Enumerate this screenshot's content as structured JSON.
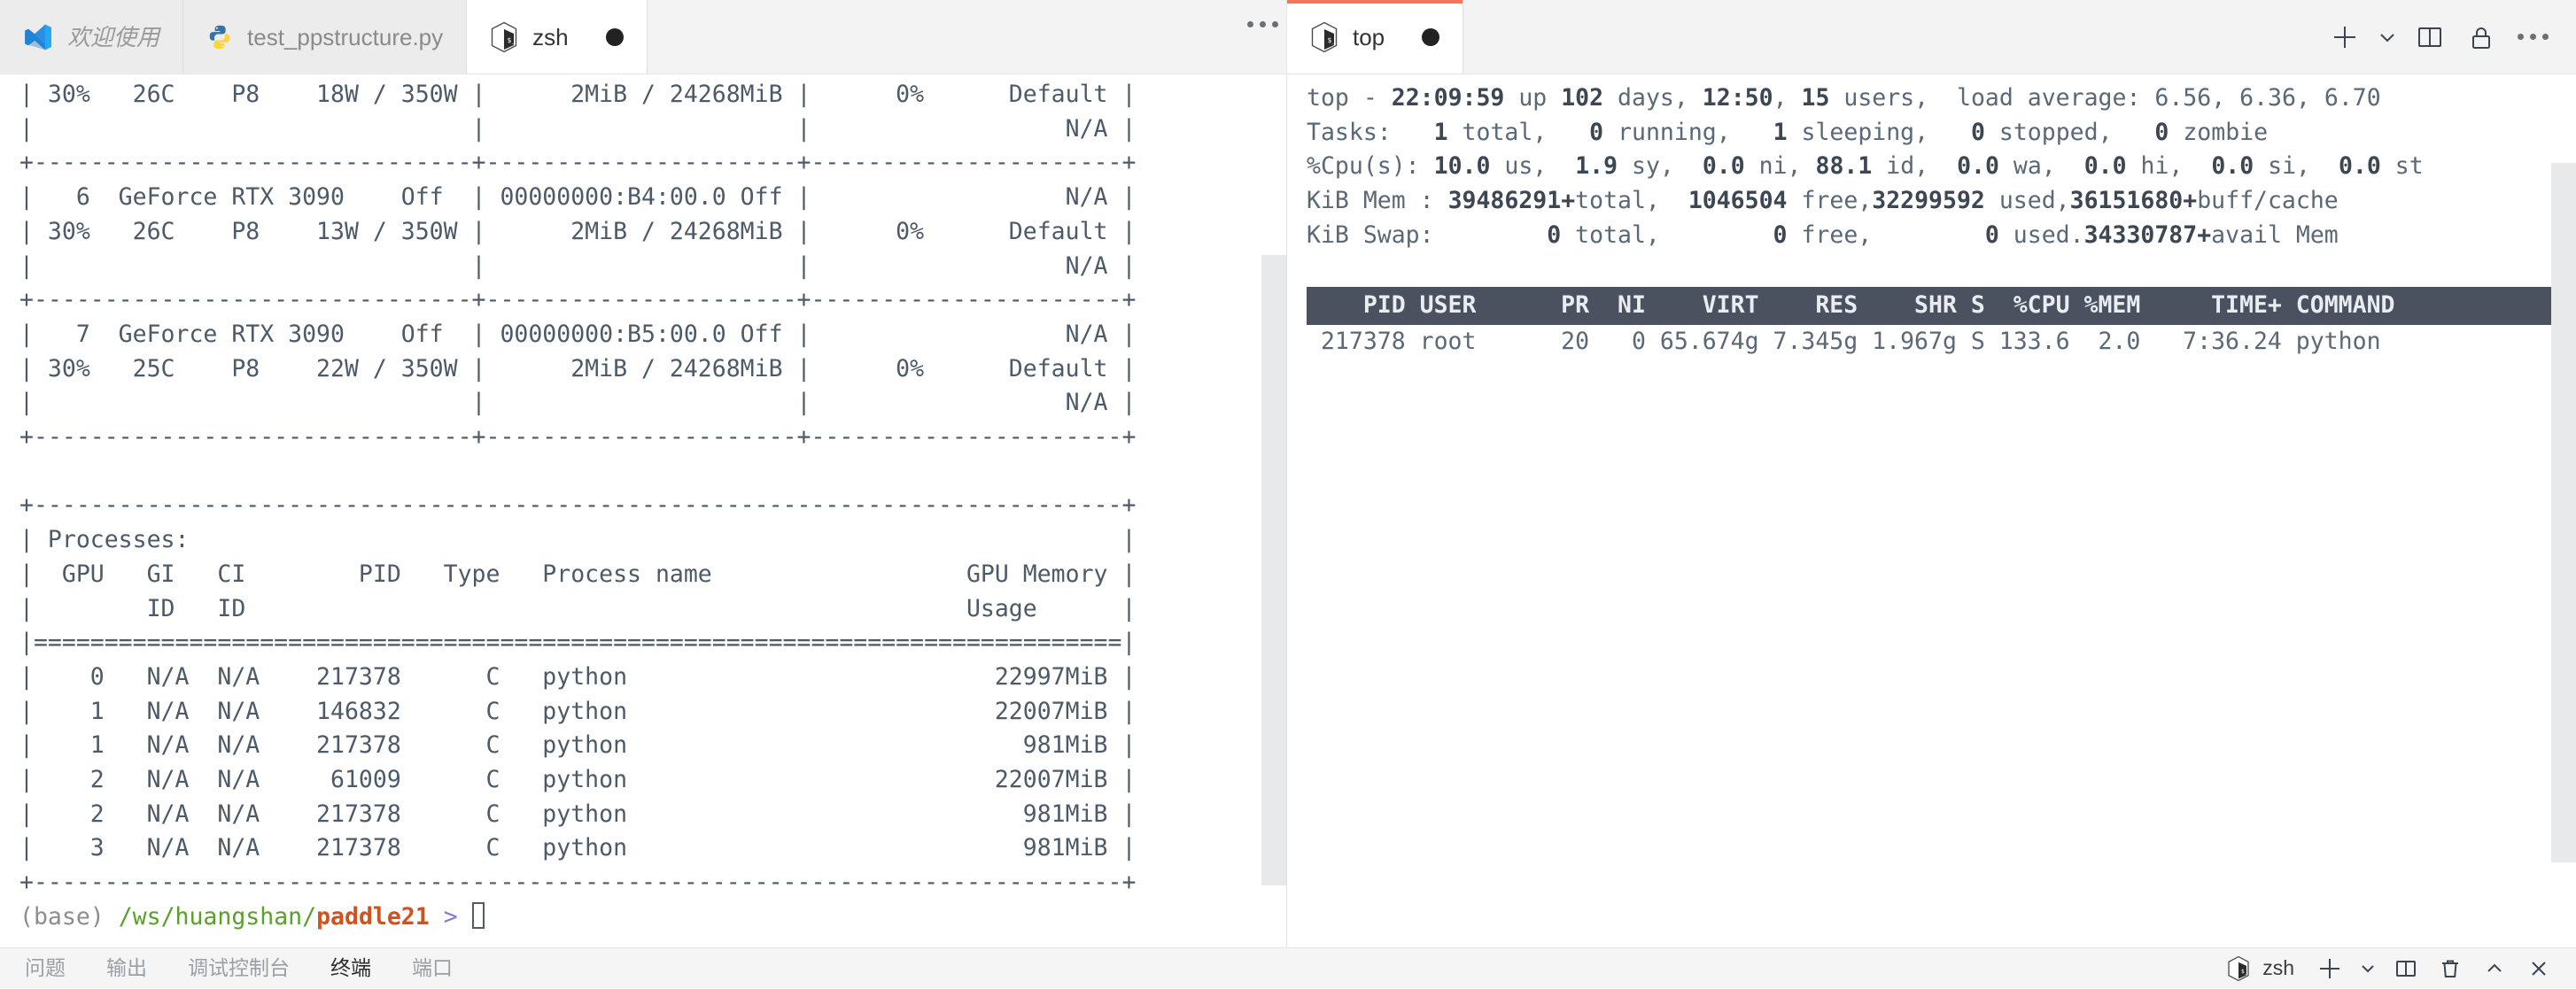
{
  "window": {
    "editor_tabs": [
      {
        "label": "欢迎使用",
        "icon": "vscode-logo-icon",
        "active": false,
        "dirty": false
      },
      {
        "label": "test_ppstructure.py",
        "icon": "python-file-icon",
        "active": false,
        "dirty": false
      },
      {
        "label": "zsh",
        "icon": "shell-terminal-icon",
        "active": true,
        "dirty": true
      }
    ],
    "editor_more_label": "...",
    "terminal_tabs": [
      {
        "label": "top",
        "icon": "shell-terminal-icon",
        "active": true,
        "dirty": true
      }
    ],
    "toolbar_buttons": [
      {
        "name": "new-terminal-button",
        "icon": "plus-icon",
        "label": "+"
      },
      {
        "name": "new-terminal-dropdown-button",
        "icon": "chevron-down-icon",
        "label": "⌄"
      },
      {
        "name": "split-terminal-button",
        "icon": "split-panel-icon",
        "label": ""
      },
      {
        "name": "lock-panel-button",
        "icon": "lock-icon",
        "label": ""
      },
      {
        "name": "more-actions-button",
        "icon": "ellipsis-icon",
        "label": "..."
      }
    ]
  },
  "left_terminal": {
    "title": "zsh",
    "lines": [
      "| 30%   26C    P8    18W / 350W |      2MiB / 24268MiB |      0%      Default |",
      "|                               |                      |                  N/A |",
      "+-------------------------------+----------------------+----------------------+",
      "|   6  GeForce RTX 3090    Off  | 00000000:B4:00.0 Off |                  N/A |",
      "| 30%   26C    P8    13W / 350W |      2MiB / 24268MiB |      0%      Default |",
      "|                               |                      |                  N/A |",
      "+-------------------------------+----------------------+----------------------+",
      "|   7  GeForce RTX 3090    Off  | 00000000:B5:00.0 Off |                  N/A |",
      "| 30%   25C    P8    22W / 350W |      2MiB / 24268MiB |      0%      Default |",
      "|                               |                      |                  N/A |",
      "+-------------------------------+----------------------+----------------------+",
      "",
      "+-----------------------------------------------------------------------------+",
      "| Processes:                                                                  |",
      "|  GPU   GI   CI        PID   Type   Process name                  GPU Memory |",
      "|        ID   ID                                                   Usage      |",
      "|=============================================================================|",
      "|    0   N/A  N/A    217378      C   python                          22997MiB |",
      "|    1   N/A  N/A    146832      C   python                          22007MiB |",
      "|    1   N/A  N/A    217378      C   python                            981MiB |",
      "|    2   N/A  N/A     61009      C   python                          22007MiB |",
      "|    2   N/A  N/A    217378      C   python                            981MiB |",
      "|    3   N/A  N/A    217378      C   python                            981MiB |",
      "+-----------------------------------------------------------------------------+"
    ],
    "prompt": {
      "env": "(base)",
      "path": "/ws/huangshan/",
      "repo": "paddle21",
      "arrow": ">",
      "input": ""
    }
  },
  "right_terminal": {
    "title": "top",
    "summary": {
      "uptime_line": {
        "program": "top",
        "sep": " - ",
        "time": "22:09:59",
        "up_label": " up ",
        "days": "102",
        "days_label": " days, ",
        "hhmm": "12:50",
        "users_count": "15",
        "users_label": " users,",
        "load_label": "  load average: ",
        "load1": "6.56",
        "load5": "6.36",
        "load15": "6.70"
      },
      "tasks_line": {
        "label": "Tasks:",
        "total": "1",
        "total_label": " total,",
        "running": "0",
        "running_label": " running,",
        "sleeping": "1",
        "sleeping_label": " sleeping,",
        "stopped": "0",
        "stopped_label": " stopped,",
        "zombie": "0",
        "zombie_label": " zombie"
      },
      "cpu_line": {
        "label": "%Cpu(s):",
        "us": "10.0",
        "us_label": " us,",
        "sy": "1.9",
        "sy_label": " sy,",
        "ni": "0.0",
        "ni_label": " ni,",
        "id": "88.1",
        "id_label": " id,",
        "wa": "0.0",
        "wa_label": " wa,",
        "hi": "0.0",
        "hi_label": " hi,",
        "si": "0.0",
        "si_label": " si,",
        "st": "0.0",
        "st_label": " st"
      },
      "mem_line": {
        "label": "KiB Mem :",
        "total": "39486291+",
        "total_label": "total,",
        "free": "1046504",
        "free_label": " free,",
        "used": "32299592",
        "used_label": " used,",
        "buffcache": "36151680+",
        "buffcache_label": "buff/cache"
      },
      "swap_line": {
        "label": "KiB Swap:",
        "total": "0",
        "total_label": " total,",
        "free": "0",
        "free_label": " free,",
        "used": "0",
        "used_label": " used.",
        "avail": "34330787+",
        "avail_label": "avail Mem"
      }
    },
    "table": {
      "header": "    PID USER      PR  NI    VIRT    RES    SHR S  %CPU %MEM     TIME+ COMMAND                                      ",
      "columns": [
        "PID",
        "USER",
        "PR",
        "NI",
        "VIRT",
        "RES",
        "SHR",
        "S",
        "%CPU",
        "%MEM",
        "TIME+",
        "COMMAND"
      ],
      "rows": [
        {
          "raw": " 217378 root      20   0 65.674g 7.345g 1.967g S 133.6  2.0   7:36.24 python",
          "pid": "217378",
          "user": "root",
          "pr": "20",
          "ni": "0",
          "virt": "65.674g",
          "res": "7.345g",
          "shr": "1.967g",
          "s": "S",
          "cpu": "133.6",
          "mem": "2.0",
          "time": "7:36.24",
          "command": "python"
        }
      ]
    }
  },
  "panel": {
    "tabs": [
      {
        "label": "问题",
        "active": false
      },
      {
        "label": "输出",
        "active": false
      },
      {
        "label": "调试控制台",
        "active": false
      },
      {
        "label": "终端",
        "active": true
      },
      {
        "label": "端口",
        "active": false
      }
    ],
    "shell_label": "zsh",
    "actions": [
      {
        "name": "new-terminal-button",
        "icon": "plus-icon"
      },
      {
        "name": "new-terminal-dropdown-button",
        "icon": "chevron-down-icon"
      },
      {
        "name": "split-terminal-button",
        "icon": "split-panel-icon"
      },
      {
        "name": "kill-terminal-button",
        "icon": "trash-icon"
      },
      {
        "name": "maximize-panel-button",
        "icon": "chevron-up-icon"
      },
      {
        "name": "close-panel-button",
        "icon": "close-icon"
      }
    ]
  },
  "colors": {
    "accent_active_tab": "#f2775a",
    "terminal_text": "#4d5a68",
    "prompt_path": "#5aa02c",
    "prompt_repo": "#d2521d",
    "prompt_arrow": "#7d7dd8",
    "top_header_bg": "#4a5260"
  }
}
